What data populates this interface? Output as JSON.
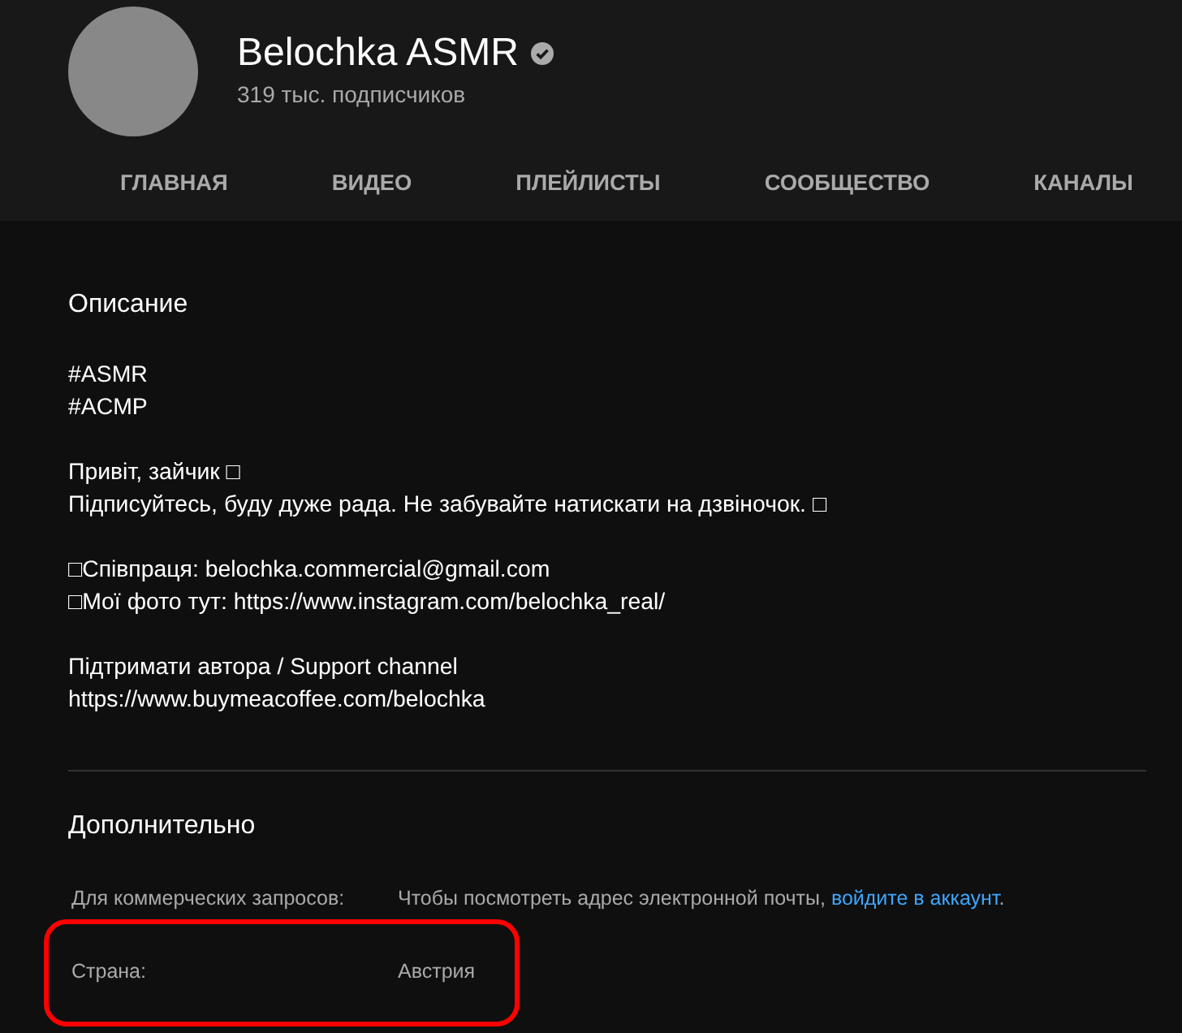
{
  "channel": {
    "name": "Belochka ASMR",
    "verified": true,
    "subscribers": "319 тыс. подписчиков"
  },
  "tabs": [
    {
      "label": "ГЛАВНАЯ",
      "selected": false
    },
    {
      "label": "ВИДЕО",
      "selected": false
    },
    {
      "label": "ПЛЕЙЛИСТЫ",
      "selected": false
    },
    {
      "label": "СООБЩЕСТВО",
      "selected": false
    },
    {
      "label": "КАНАЛЫ",
      "selected": false
    }
  ],
  "description": {
    "title": "Описание",
    "paragraphs": [
      [
        "#ASMR",
        "#ACMP"
      ],
      [
        "Привіт, зайчик □",
        "Підписуйтесь, буду дуже рада. Не забувайте натискати на дзвіночок. □"
      ],
      [
        "□Співпраця: belochka.commercial@gmail.com",
        "□Мої фото тут: https://www.instagram.com/belochka_real/"
      ],
      [
        "Підтримати автора / Support channel",
        "https://www.buymeacoffee.com/belochka"
      ]
    ]
  },
  "details": {
    "title": "Дополнительно",
    "rows": [
      {
        "label": "Для коммерческих запросов:",
        "value": "Чтобы посмотреть адрес электронной почты,",
        "link": "войдите в аккаунт",
        "suffix": ".",
        "highlighted": false
      },
      {
        "label": "Страна:",
        "value": "Австрия",
        "highlighted": true
      }
    ]
  }
}
